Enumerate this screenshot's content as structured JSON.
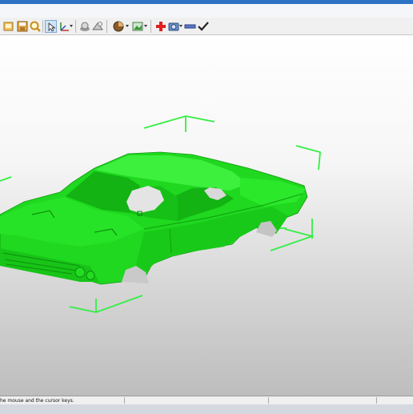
{
  "toolbar": {
    "icons": [
      "open-icon",
      "save-icon",
      "render-icon",
      "zoom-icon",
      "select-pointer-icon",
      "axis-icon",
      "shading-icon",
      "lighting-icon",
      "material-icon",
      "view-icon",
      "add-icon",
      "camera-icon",
      "minus-icon",
      "checkmark-icon"
    ],
    "accent": "#2d72c4"
  },
  "viewport": {
    "model_color": "#1fd81f",
    "bbox_color": "#33ee44",
    "background_top": "#ffffff",
    "background_bottom": "#bdbdbd"
  },
  "statusbar": {
    "text": "he mouse and the cursor keys."
  }
}
